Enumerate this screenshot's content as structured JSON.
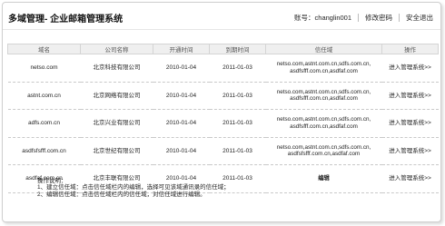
{
  "header": {
    "title": "多域管理- 企业邮箱管理系统",
    "account": "账号：changlin001",
    "change_password": "修改密码",
    "logout": "安全退出"
  },
  "table": {
    "columns": [
      "域名",
      "公司名称",
      "开通时间",
      "到期时间",
      "信任域",
      "操作"
    ],
    "rows": [
      {
        "domain": "netso.com",
        "company": "北京科技有限公司",
        "start": "2010-01-04",
        "end": "2011-01-03",
        "trusted": [
          "netso.com,astnt.com.cn,sdfs.com.cn,",
          "asdfsfff.com.cn,asdfaf.com"
        ],
        "action": "进入管理系统>>"
      },
      {
        "domain": "astnt.com.cn",
        "company": "北京网络有限公司",
        "start": "2010-01-04",
        "end": "2011-01-03",
        "trusted": [
          "netso.com,astnt.com.cn,sdfs.com.cn,",
          "asdfsfff.com.cn,asdfaf.com"
        ],
        "action": "进入管理系统>>"
      },
      {
        "domain": "adfs.com.cn",
        "company": "北京兴业有限公司",
        "start": "2010-01-04",
        "end": "2011-01-03",
        "trusted": [
          "netso.com,astnt.com.cn,sdfs.com.cn,",
          "asdfsfff.com.cn,asdfaf.com"
        ],
        "action": "进入管理系统>>"
      },
      {
        "domain": "asdfsfsfff.com.cn",
        "company": "北京世纪有限公司",
        "start": "2010-01-04",
        "end": "2011-01-03",
        "trusted": [
          "netso.com,astnt.com.cn,sdfs.com.cn,",
          "asdfsfsfff.com.cn,asdfaf.com"
        ],
        "action": "进入管理系统>>"
      },
      {
        "domain": "asdfaf.com.cn",
        "company": "北京丰联有限公司",
        "start": "2010-01-04",
        "end": "2011-01-03",
        "trusted_edit": "编辑",
        "action": "进入管理系统>>"
      }
    ]
  },
  "notes": {
    "title": "操作说明：",
    "line1": "1、建立信任域：点击信任域栏内的编辑，选择可见该域通讯录的信任域；",
    "line2": "2、编辑信任域：点击信任域栏内的信任域，对信任域进行编辑。"
  }
}
